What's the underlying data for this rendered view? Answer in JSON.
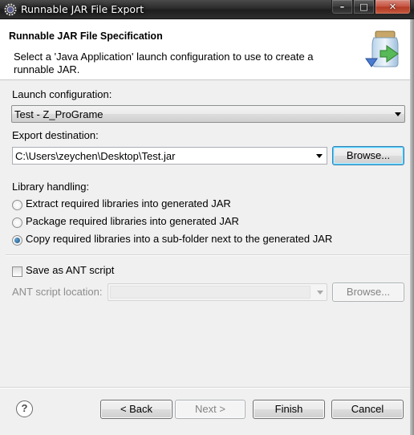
{
  "window": {
    "title": "Runnable JAR File Export",
    "buttons": {
      "minimize": "–",
      "maximize": "□",
      "close": "✕"
    }
  },
  "banner": {
    "title": "Runnable JAR File Specification",
    "description": "Select a 'Java Application' launch configuration to use to create a runnable JAR.",
    "image": "jar-export-icon"
  },
  "launch": {
    "label": "Launch configuration:",
    "value": "Test - Z_ProGrame"
  },
  "export": {
    "label": "Export destination:",
    "value": "C:\\Users\\zeychen\\Desktop\\Test.jar",
    "browse": "Browse..."
  },
  "library": {
    "label": "Library handling:",
    "options": [
      {
        "label": "Extract required libraries into generated JAR",
        "selected": false
      },
      {
        "label": "Package required libraries into generated JAR",
        "selected": false
      },
      {
        "label": "Copy required libraries into a sub-folder next to the generated JAR",
        "selected": true
      }
    ]
  },
  "ant": {
    "checkbox_label": "Save as ANT script",
    "checked": false,
    "location_label": "ANT script location:",
    "location_value": "",
    "browse": "Browse..."
  },
  "footer": {
    "help": "?",
    "back": "< Back",
    "next": "Next >",
    "finish": "Finish",
    "cancel": "Cancel"
  },
  "colors": {
    "accent": "#3c7fb1",
    "titlebar": "#2b2b2b"
  }
}
